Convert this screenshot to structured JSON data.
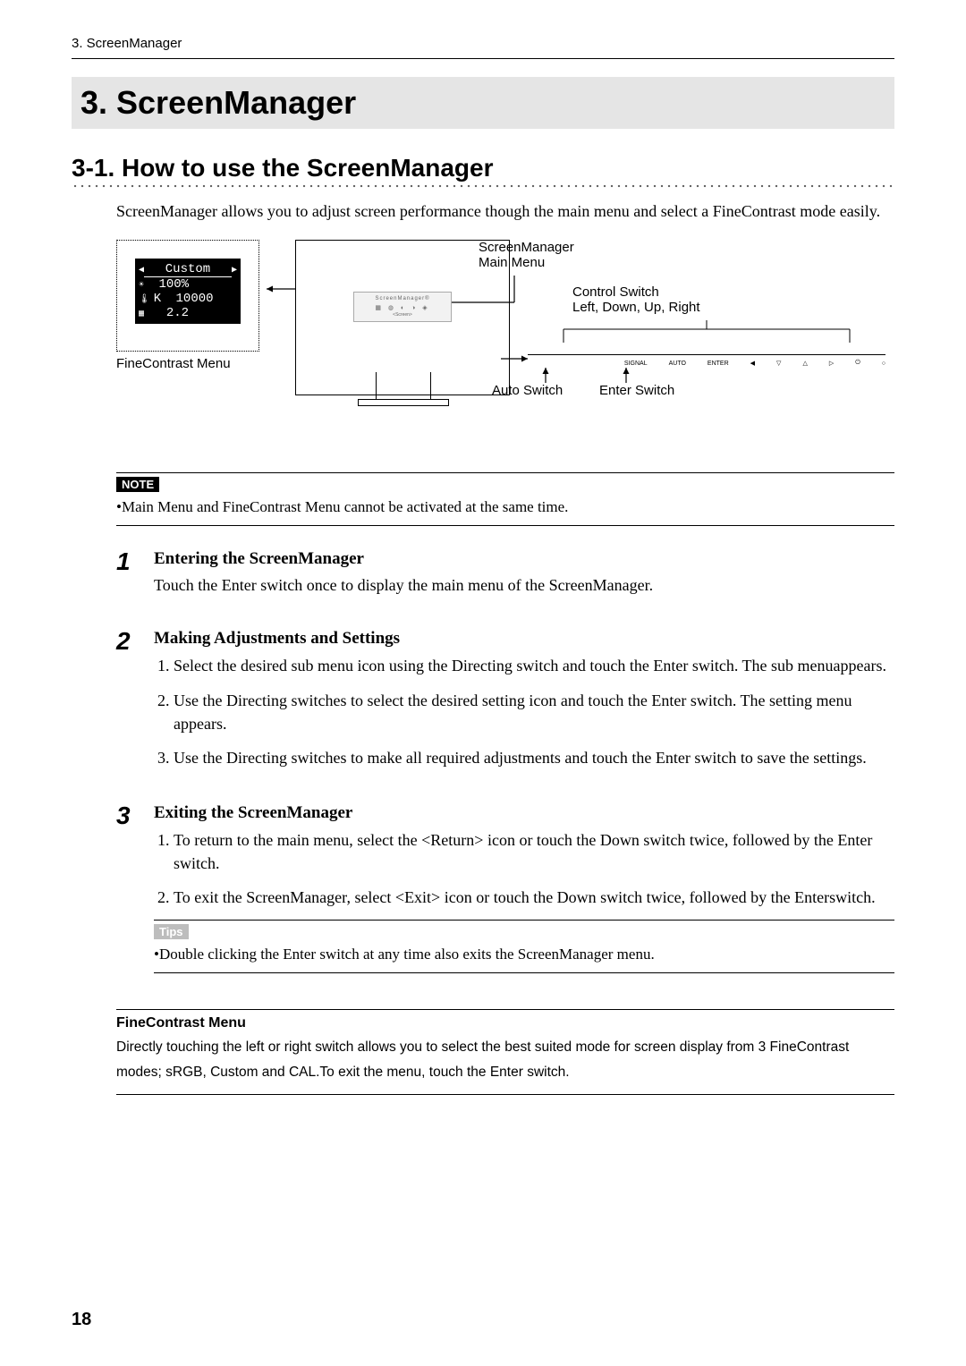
{
  "running_head": "3. ScreenManager",
  "chapter_title": "3. ScreenManager",
  "section_title": "3-1. How to use the ScreenManager",
  "intro": "ScreenManager allows you to adjust screen performance though the main menu and select a FineContrast mode easily.",
  "diagram": {
    "fc_menu": {
      "mode": "Custom",
      "brightness": "100%",
      "temperature": "10000",
      "gamma": "2.2"
    },
    "fc_menu_label": "FineContrast Menu",
    "sm_menu_title": "ScreenManager®",
    "sm_menu_sub": "<Screen>",
    "sm_label": "ScreenManager\nMain Menu",
    "ctrl_label": "Control Switch\nLeft, Down, Up, Right",
    "switch_labels": [
      "SIGNAL",
      "AUTO",
      "ENTER"
    ],
    "auto_label": "Auto Switch",
    "enter_label": "Enter Switch"
  },
  "note": {
    "tag": "NOTE",
    "text": "•Main Menu and FineContrast Menu cannot be activated at the same time."
  },
  "steps": [
    {
      "num": "1",
      "heading": "Entering the ScreenManager",
      "para": "Touch the Enter switch once to display the main menu of the ScreenManager."
    },
    {
      "num": "2",
      "heading": "Making Adjustments and Settings",
      "list": [
        "Select the desired sub menu icon using the Directing switch and touch the Enter switch. The sub menuappears.",
        "Use the Directing switches to select the desired setting icon and touch the Enter switch. The setting menu appears.",
        "Use the Directing switches to make all required adjustments and touch the Enter switch to save the settings."
      ]
    },
    {
      "num": "3",
      "heading": "Exiting the ScreenManager",
      "list": [
        "To return to the main menu, select the <Return> icon or touch the Down switch  twice, followed by the Enter switch.",
        "To exit the ScreenManager, select <Exit> icon or touch the Down switch  twice, followed by the Enterswitch."
      ],
      "tips": {
        "tag": "Tips",
        "text": "•Double clicking the Enter switch at any time also exits the ScreenManager menu."
      }
    }
  ],
  "fc_section": {
    "label": "FineContrast Menu",
    "text": "Directly touching the left  or right  switch allows you to select the best suited mode for screen display from 3 FineContrast modes; sRGB, Custom and CAL.To exit the menu, touch the Enter switch."
  },
  "page_number": "18"
}
